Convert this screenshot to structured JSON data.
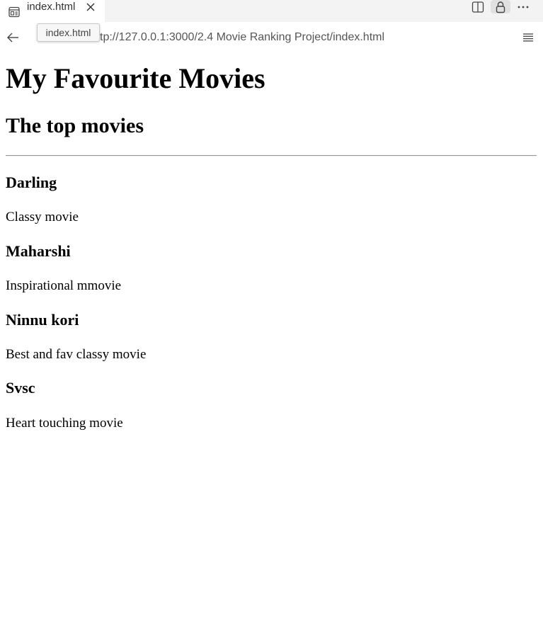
{
  "browser": {
    "tab": {
      "title": "index.html",
      "icon": "page-preview-icon"
    },
    "tooltip": "index.html",
    "address_bar": {
      "url_display": "tp://127.0.0.1:3000/2.4 Movie Ranking Project/index.html"
    },
    "controls": {
      "back": "back-arrow-icon",
      "split": "split-view-icon",
      "lock": "lock-icon",
      "more": "more-dots-icon",
      "menu": "hamburger-menu-icon"
    }
  },
  "page": {
    "title": "My Favourite Movies",
    "subtitle": "The top movies",
    "movies": [
      {
        "title": "Darling",
        "description": "Classy movie"
      },
      {
        "title": "Maharshi",
        "description": "Inspirational mmovie"
      },
      {
        "title": "Ninnu kori",
        "description": "Best and fav classy movie"
      },
      {
        "title": "Svsc",
        "description": "Heart touching movie"
      }
    ]
  }
}
